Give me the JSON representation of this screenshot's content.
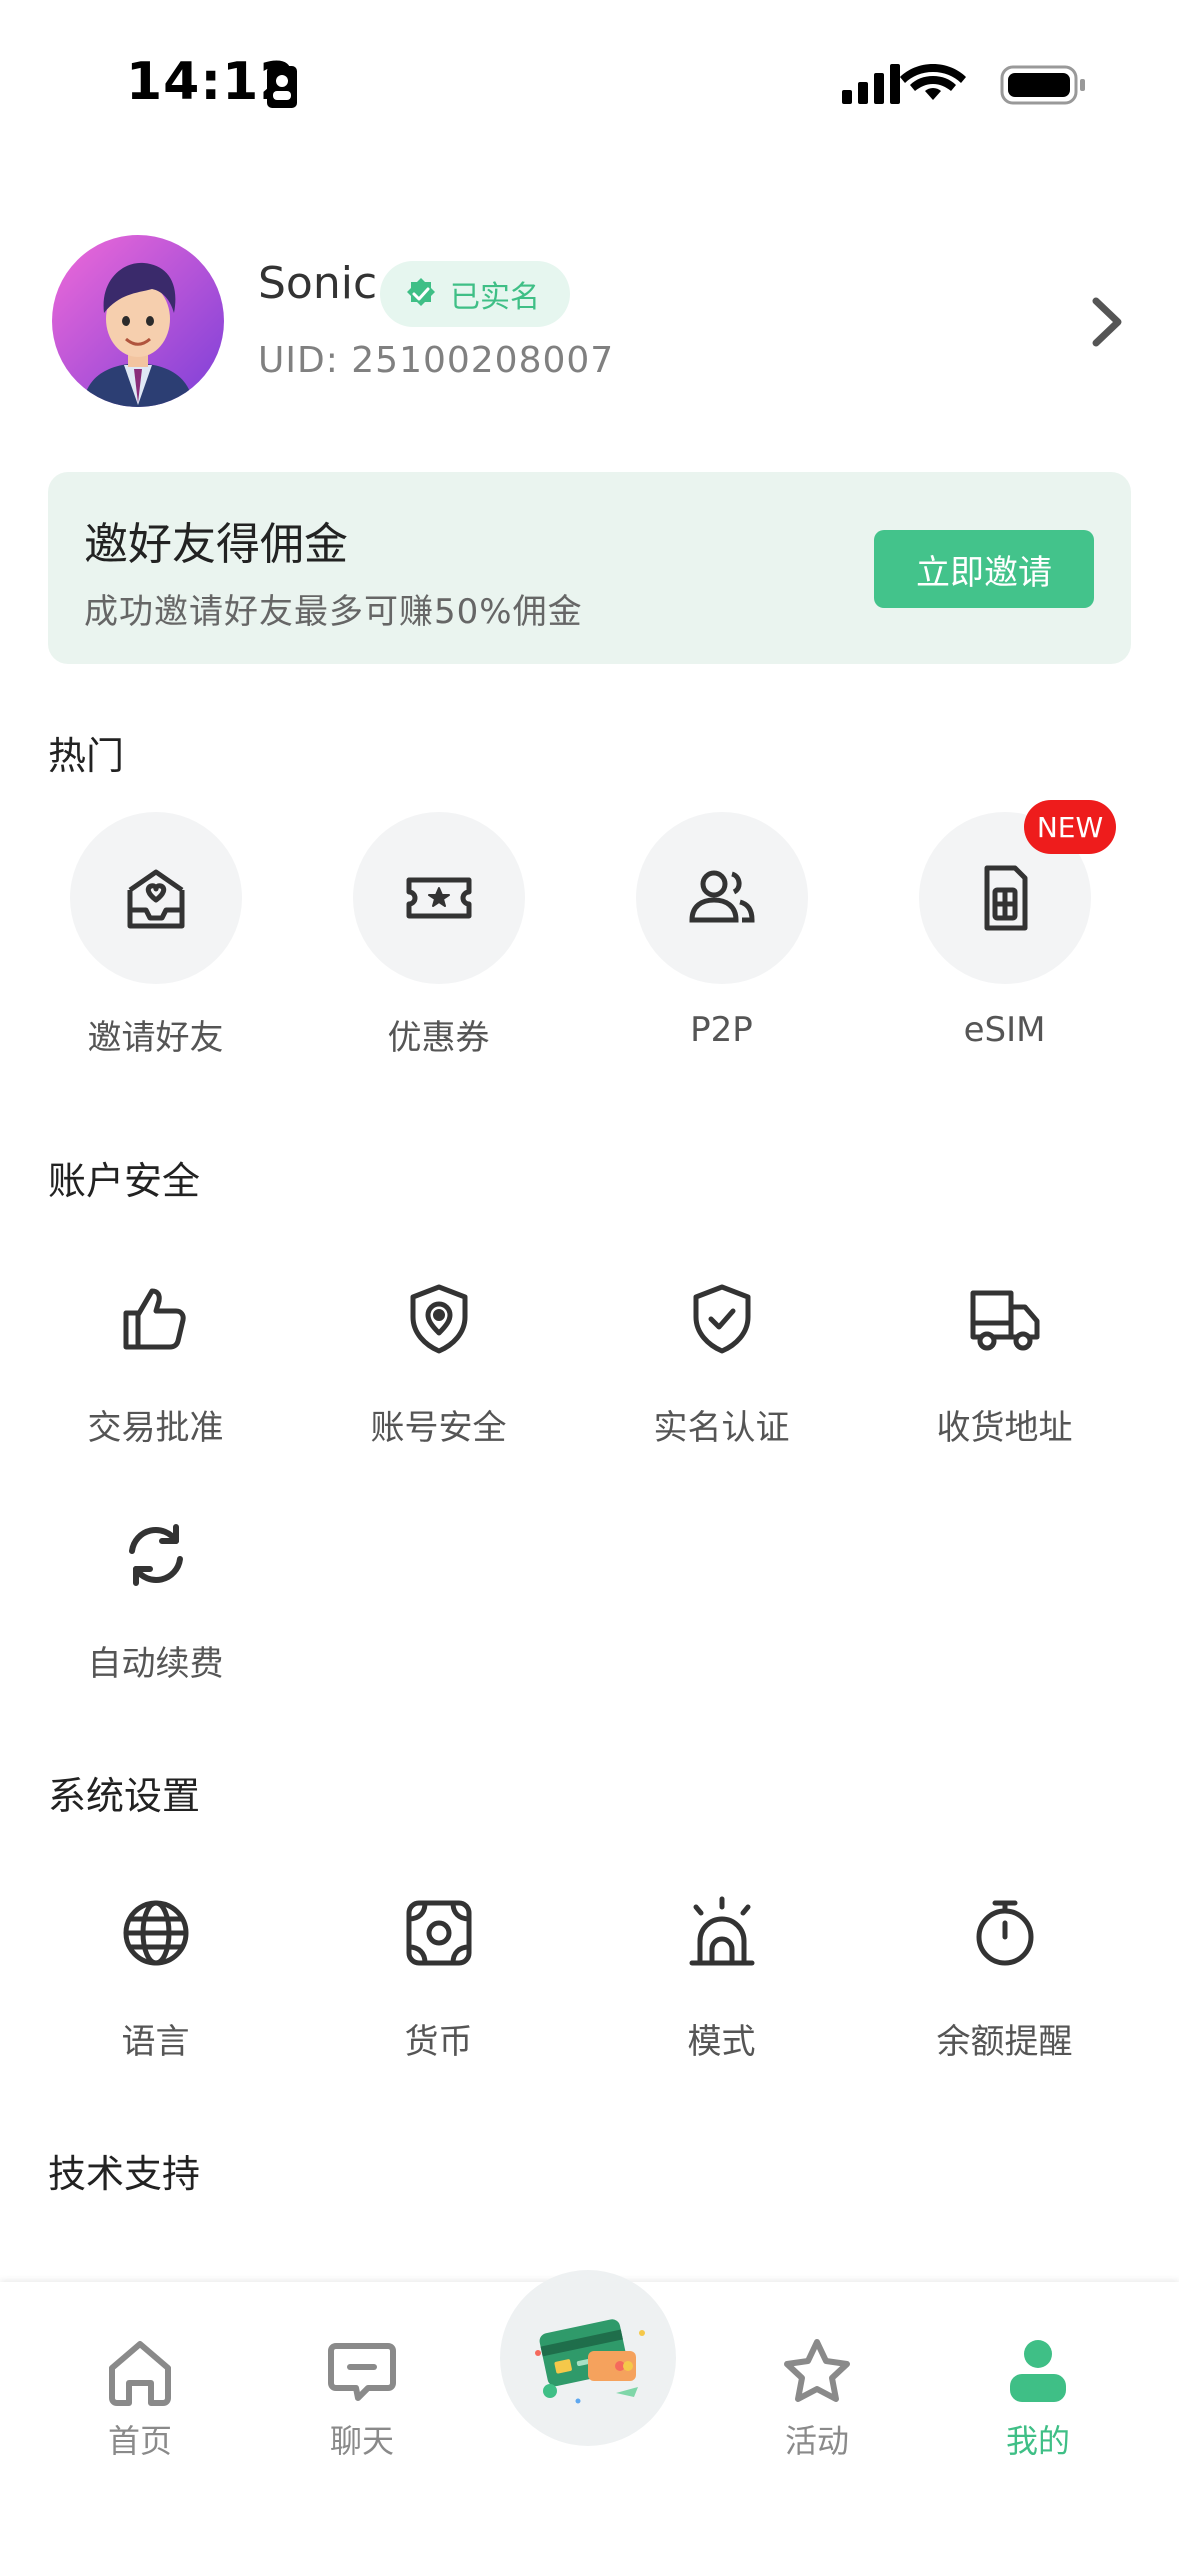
{
  "status_bar": {
    "time": "14:12"
  },
  "profile": {
    "name": "Sonic",
    "verified_label": "已实名",
    "uid": "UID: 25100208007"
  },
  "invite_banner": {
    "title": "邀好友得佣金",
    "subtitle": "成功邀请好友最多可赚50%佣金",
    "button": "立即邀请"
  },
  "sections": {
    "hot": {
      "title": "热门",
      "items": [
        {
          "label": "邀请好友",
          "icon": "envelope-heart-icon"
        },
        {
          "label": "优惠券",
          "icon": "ticket-icon"
        },
        {
          "label": "P2P",
          "icon": "users-icon"
        },
        {
          "label": "eSIM",
          "icon": "sim-card-icon",
          "badge": "NEW"
        }
      ]
    },
    "account_security": {
      "title": "账户安全",
      "items": [
        {
          "label": "交易批准",
          "icon": "thumbs-up-icon"
        },
        {
          "label": "账号安全",
          "icon": "shield-location-icon"
        },
        {
          "label": "实名认证",
          "icon": "shield-check-icon"
        },
        {
          "label": "收货地址",
          "icon": "truck-icon"
        },
        {
          "label": "自动续费",
          "icon": "refresh-icon"
        }
      ]
    },
    "system_settings": {
      "title": "系统设置",
      "items": [
        {
          "label": "语言",
          "icon": "globe-icon"
        },
        {
          "label": "货币",
          "icon": "money-icon"
        },
        {
          "label": "模式",
          "icon": "sunrise-icon"
        },
        {
          "label": "余额提醒",
          "icon": "stopwatch-icon"
        }
      ]
    },
    "tech_support": {
      "title": "技术支持"
    }
  },
  "tab_bar": {
    "tabs": [
      {
        "label": "首页",
        "icon": "home-icon"
      },
      {
        "label": "聊天",
        "icon": "chat-icon"
      },
      {
        "label": "",
        "icon": "card-illustration-icon"
      },
      {
        "label": "活动",
        "icon": "star-icon"
      },
      {
        "label": "我的",
        "icon": "person-icon",
        "active": true
      }
    ]
  },
  "colors": {
    "accent": "#43c38b",
    "banner_bg": "#eaf4ef",
    "badge_red": "#ee1c1c"
  }
}
